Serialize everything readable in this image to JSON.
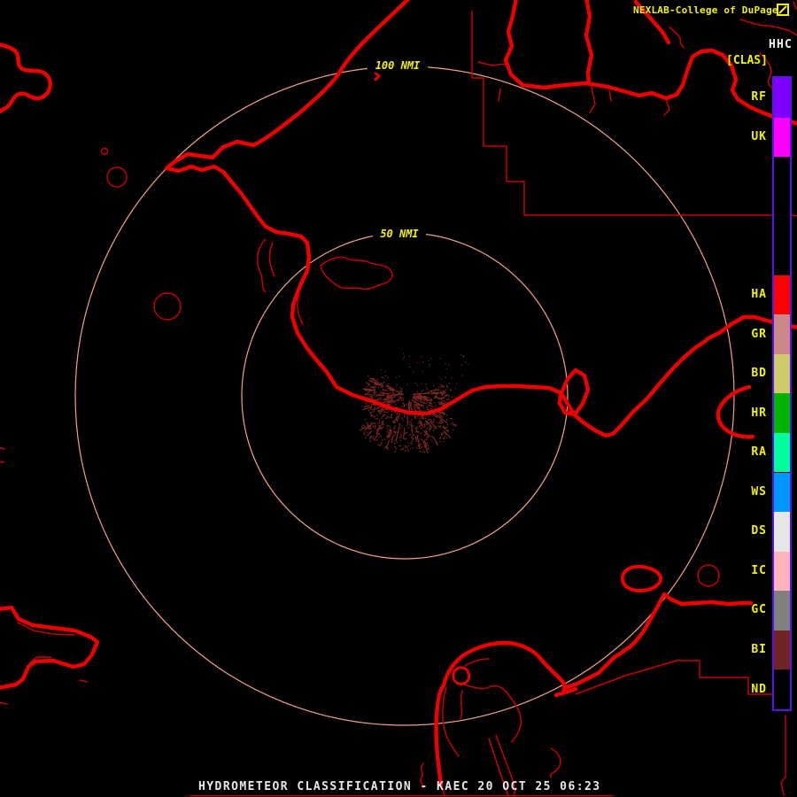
{
  "header": {
    "brand": "NEXLAB-College of DuPage",
    "product_code": "HHC",
    "product_tag": "[CLAS]"
  },
  "range_rings": [
    {
      "label": "100 NMI"
    },
    {
      "label": "50 NMI"
    }
  ],
  "legend": {
    "categories": [
      {
        "code": "RF",
        "color": "#8000FF",
        "slot": 0
      },
      {
        "code": "UK",
        "color": "#FF00FF",
        "slot": 1
      },
      {
        "code": "HA",
        "color": "#FF0000",
        "slot": 5
      },
      {
        "code": "GR",
        "color": "#CC8888",
        "slot": 6
      },
      {
        "code": "BD",
        "color": "#CFCB6A",
        "slot": 7
      },
      {
        "code": "HR",
        "color": "#00B400",
        "slot": 8
      },
      {
        "code": "RA",
        "color": "#00FF9C",
        "slot": 9
      },
      {
        "code": "WS",
        "color": "#0096FF",
        "slot": 10
      },
      {
        "code": "DS",
        "color": "#E6E6E6",
        "slot": 11
      },
      {
        "code": "IC",
        "color": "#FFB4BC",
        "slot": 12
      },
      {
        "code": "GC",
        "color": "#808080",
        "slot": 13
      },
      {
        "code": "BI",
        "color": "#6E2424",
        "slot": 14
      },
      {
        "code": "ND",
        "color": "#000000",
        "slot": 15
      }
    ]
  },
  "status_bar": {
    "text": "HYDROMETEOR CLASSIFICATION - KAEC 20 OCT 25 06:23"
  },
  "colors": {
    "background": "#000000",
    "map_line_thick": "#EE0000",
    "map_line_thin": "#C80000",
    "range_ring": "#F2A285",
    "label_yellow": "#F2F200",
    "text_white": "#E8E8E8",
    "legend_border": "#5A14E8",
    "echo": "#7A2622"
  }
}
